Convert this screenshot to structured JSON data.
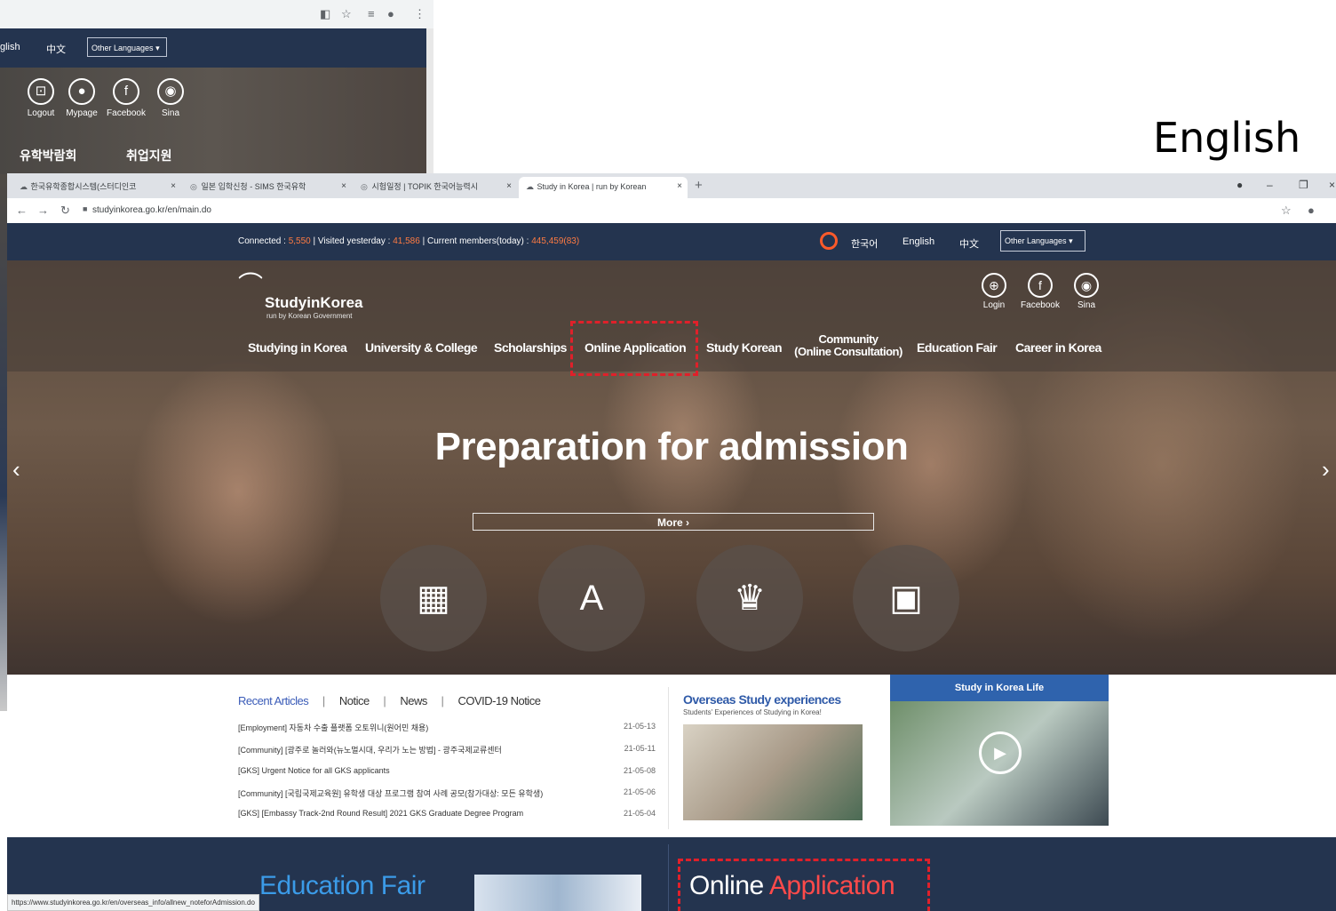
{
  "label": "English",
  "bg_window": {
    "langs": [
      "glish",
      "中文"
    ],
    "select": "Other Languages",
    "utils": [
      {
        "label": "Logout",
        "glyph": "⊡"
      },
      {
        "label": "Mypage",
        "glyph": "●"
      },
      {
        "label": "Facebook",
        "glyph": "f"
      },
      {
        "label": "Sina",
        "glyph": "◉"
      }
    ],
    "nav": [
      "유학박람회",
      "취업지원"
    ]
  },
  "browser": {
    "tabs": [
      {
        "title": "한국유학종합시스템(스터디인코",
        "icon": "☁"
      },
      {
        "title": "일본 입학신청 - SIMS 한국유학",
        "icon": "◎"
      },
      {
        "title": "시험일정 | TOPIK 한국어능력시",
        "icon": "◎"
      },
      {
        "title": "Study in Korea | run by Korean",
        "icon": "☁"
      }
    ],
    "close_glyph": "×",
    "new_tab": "+",
    "url": "studyinkorea.go.kr/en/main.do",
    "status_url": "https://www.studyinkorea.go.kr/en/overseas_info/allnew_noteforAdmission.do"
  },
  "site": {
    "counters": {
      "connected_label": "Connected : ",
      "connected": "5,550",
      "visited_label": " | Visited yesterday : ",
      "visited": "41,586",
      "members_label": " | Current members(today) : ",
      "members": "445,459(83)"
    },
    "langs": {
      "ko": "한국어",
      "en": "English",
      "zh": "中文"
    },
    "lang_select": "Other Languages",
    "logo": {
      "name": "StudyinKorea",
      "sub": "run by Korean Government"
    },
    "utils": [
      {
        "label": "Login",
        "glyph": "⊕"
      },
      {
        "label": "Facebook",
        "glyph": "f"
      },
      {
        "label": "Sina",
        "glyph": "◉"
      }
    ],
    "nav": {
      "studying": "Studying in Korea",
      "university": "University & College",
      "scholarships": "Scholarships",
      "online": "Online Application",
      "study_korean": "Study Korean",
      "community_1": "Community",
      "community_2": "(Online Consultation)",
      "fair": "Education Fair",
      "career": "Career in Korea"
    },
    "hero_title": "Preparation for admission",
    "more": "More  ›",
    "quick_icons": [
      {
        "name": "ranking-podium-icon",
        "glyph": "▦"
      },
      {
        "name": "document-hand-icon",
        "glyph": "A"
      },
      {
        "name": "trophy-icon",
        "glyph": "♛"
      },
      {
        "name": "certificate-icon",
        "glyph": "▣"
      }
    ],
    "tabs": {
      "recent": "Recent Articles",
      "notice": "Notice",
      "news": "News",
      "covid": "COVID-19 Notice",
      "sep": "|"
    },
    "articles": [
      {
        "title": "[Employment] 자동차 수출 플랫폼 오토위니(원어민 채용)",
        "date": "21-05-13"
      },
      {
        "title": "[Community] [광주로 놀러와(뉴노멀시대, 우리가 노는 방법] - 광주국제교류센터",
        "date": "21-05-11"
      },
      {
        "title": "[GKS] Urgent Notice for all GKS applicants",
        "date": "21-05-08"
      },
      {
        "title": "[Community] [국립국제교육원] 유학생 대상 프로그램 참여 사례 공모(참가대상: 모든 유학생)",
        "date": "21-05-06"
      },
      {
        "title": "[GKS] [Embassy Track-2nd Round Result] 2021 GKS Graduate Degree Program",
        "date": "21-05-04"
      }
    ],
    "overseas": {
      "title": "Overseas Study experiences",
      "sub": "Students' Experiences of Studying in Korea!"
    },
    "life": {
      "title": "Study in Korea Life",
      "play": "▶"
    },
    "education_fair": "Education Fair",
    "online_app": {
      "word1": "Online ",
      "word2": "Application"
    }
  }
}
